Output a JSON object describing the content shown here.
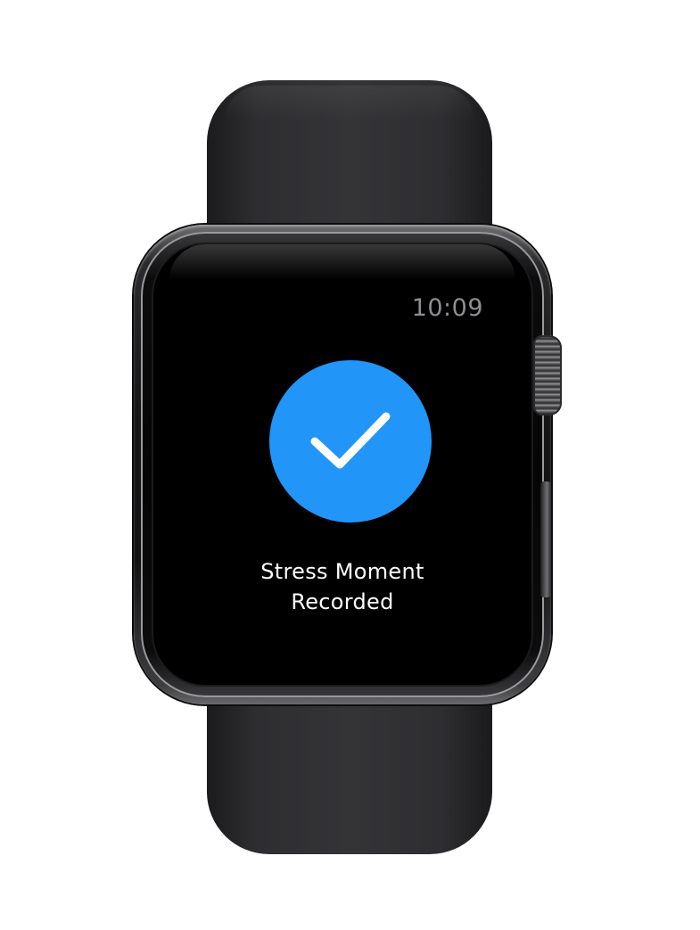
{
  "device": {
    "type": "smartwatch",
    "band_color": "#2e2e31",
    "case_color": "#151516"
  },
  "status_bar": {
    "time": "10:09"
  },
  "confirmation": {
    "icon": "checkmark-icon",
    "accent_color": "#2196f8",
    "line1": "Stress Moment",
    "line2": "Recorded"
  }
}
